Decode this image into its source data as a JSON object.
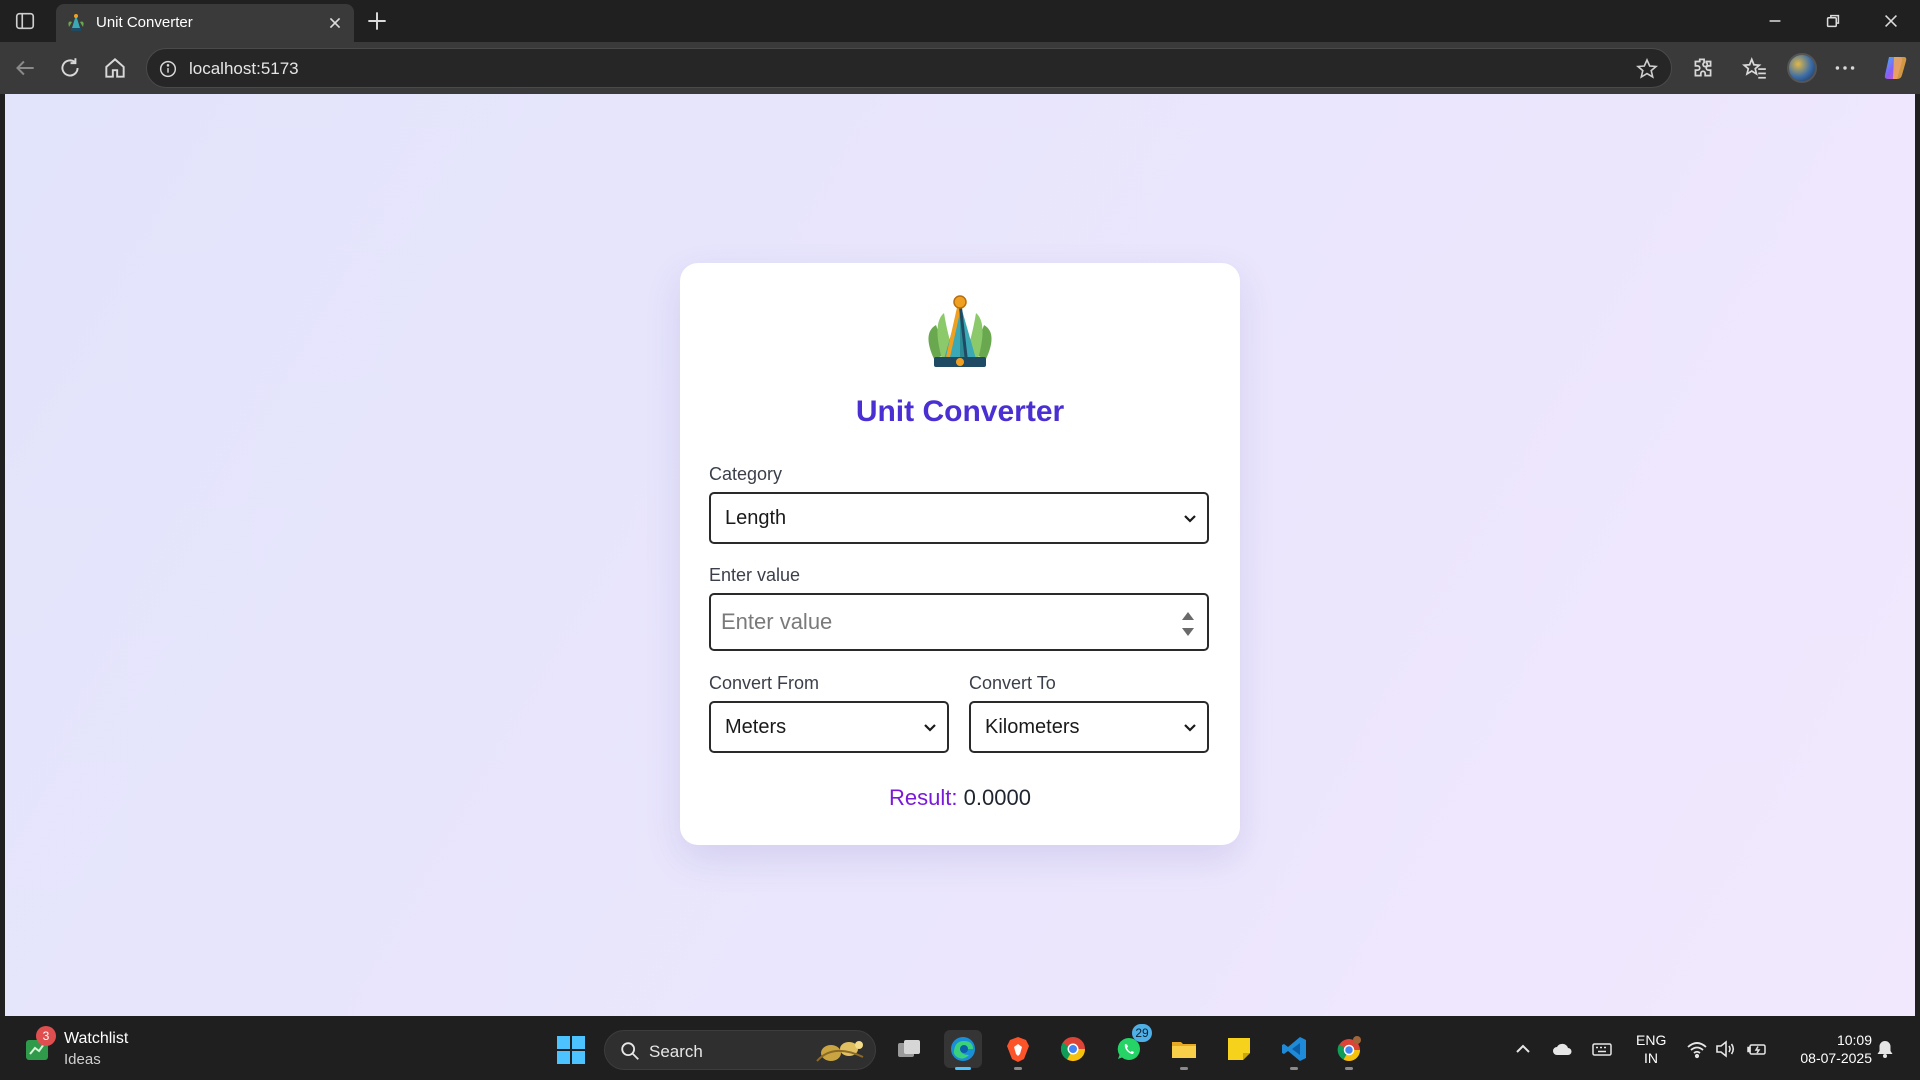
{
  "browser": {
    "tab_title": "Unit Converter",
    "url": "localhost:5173"
  },
  "app": {
    "title": "Unit Converter",
    "category": {
      "label": "Category",
      "selected": "Length"
    },
    "value_input": {
      "label": "Enter value",
      "placeholder": "Enter value",
      "value": ""
    },
    "convert_from": {
      "label": "Convert From",
      "selected": "Meters"
    },
    "convert_to": {
      "label": "Convert To",
      "selected": "Kilometers"
    },
    "result": {
      "label": "Result:",
      "value": "0.0000"
    },
    "accent_color": "#4a2fd2",
    "result_label_color": "#7a1ad8"
  },
  "taskbar": {
    "widget": {
      "badge": "3",
      "title": "Watchlist",
      "subtitle": "Ideas"
    },
    "search_label": "Search",
    "apps": [
      {
        "name": "task-view"
      },
      {
        "name": "edge",
        "active": true
      },
      {
        "name": "brave"
      },
      {
        "name": "chrome"
      },
      {
        "name": "whatsapp",
        "badge": "29"
      },
      {
        "name": "file-explorer"
      },
      {
        "name": "sticky-notes"
      },
      {
        "name": "vscode"
      },
      {
        "name": "chrome-profile"
      }
    ],
    "tray": {
      "language_line1": "ENG",
      "language_line2": "IN",
      "time": "10:09",
      "date": "08-07-2025"
    }
  }
}
